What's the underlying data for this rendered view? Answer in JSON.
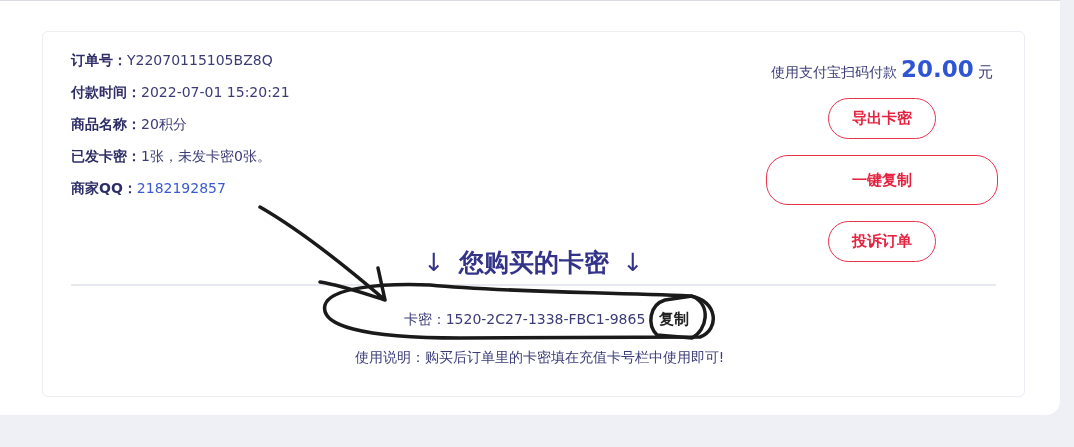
{
  "order_info": [
    {
      "label": "订单号：",
      "value": "Y22070115105BZ8Q",
      "kind": "text"
    },
    {
      "label": "付款时间：",
      "value": "2022-07-01 15:20:21",
      "kind": "text"
    },
    {
      "label": "商品名称：",
      "value": "20积分",
      "kind": "text"
    },
    {
      "label": "已发卡密：",
      "value": "1张，未发卡密0张。",
      "kind": "text"
    },
    {
      "label": "商家QQ：",
      "value": "2182192857",
      "kind": "link"
    }
  ],
  "payment": {
    "prefix": "使用支付宝扫码付款",
    "amount": "20.00",
    "currency": "元"
  },
  "actions": [
    {
      "label": "导出卡密",
      "kind": "small"
    },
    {
      "label": "一键复制",
      "kind": "wide"
    },
    {
      "label": "投诉订单",
      "kind": "small"
    }
  ],
  "codes_section": {
    "heading_left": "↓",
    "heading": "您购买的卡密",
    "heading_right": "↓",
    "code_label": "卡密：",
    "code": "1520-2C27-1338-FBC1-9865",
    "copy_button": "复制",
    "instructions": "使用说明：购买后订单里的卡密填在充值卡号栏中使用即可!"
  }
}
